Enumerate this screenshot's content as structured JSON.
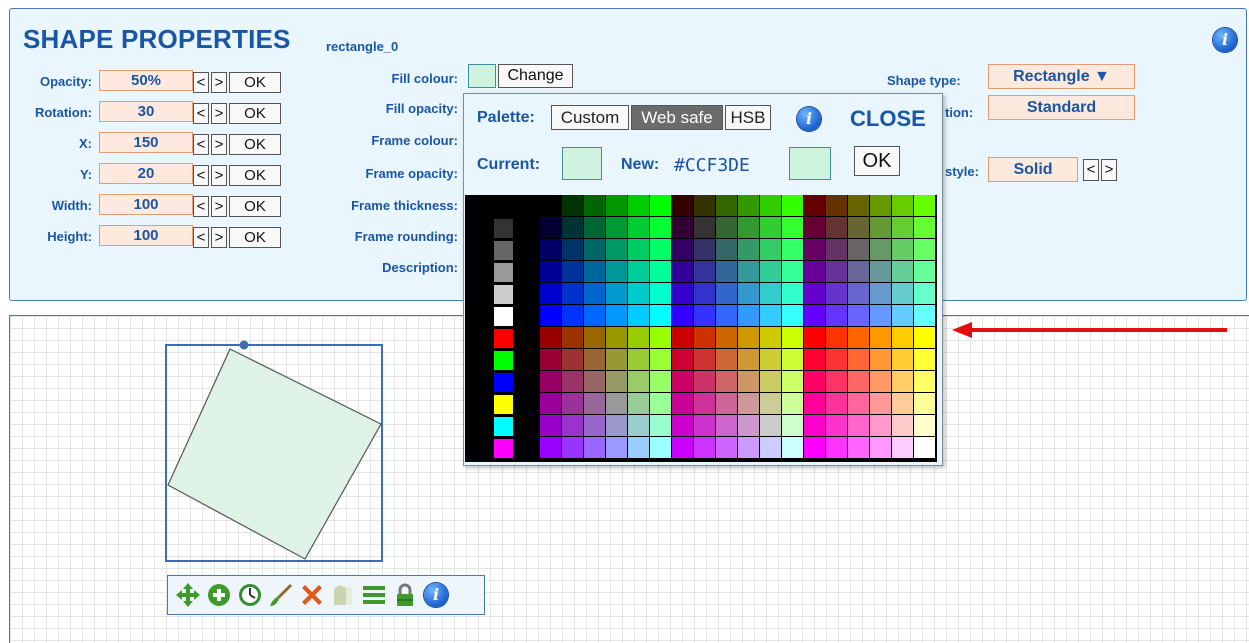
{
  "panel": {
    "title": "SHAPE PROPERTIES",
    "shape_name": "rectangle_0",
    "info_icon": "i",
    "left_fields": [
      {
        "label": "Opacity:",
        "value": "50%"
      },
      {
        "label": "Rotation:",
        "value": "30"
      },
      {
        "label": "X:",
        "value": "150"
      },
      {
        "label": "Y:",
        "value": "20"
      },
      {
        "label": "Width:",
        "value": "100"
      },
      {
        "label": "Height:",
        "value": "100"
      }
    ],
    "dec_label": "<",
    "inc_label": ">",
    "ok_label": "OK",
    "middle_labels": [
      "Fill colour:",
      "Fill opacity:",
      "Frame colour:",
      "Frame opacity:",
      "Frame thickness:",
      "Frame rounding:",
      "Description:"
    ],
    "fill_colour": "#cff3df",
    "change_label": "Change",
    "shape_type_label": "Shape type:",
    "shape_type_value": "Rectangle ▼",
    "rotation_mode_label_partial": "tion:",
    "rotation_mode_value": "Standard",
    "frame_style_label_partial": "style:",
    "frame_style_value": "Solid"
  },
  "palette": {
    "palette_label": "Palette:",
    "tabs": [
      {
        "label": "Custom",
        "active": false
      },
      {
        "label": "Web safe",
        "active": true
      },
      {
        "label": "HSB",
        "active": false
      }
    ],
    "close_label": "CLOSE",
    "current_label": "Current:",
    "current_colour": "#cff3df",
    "new_label": "New:",
    "new_value": "#CCF3DE",
    "new_colour": "#ccf3de",
    "ok_label": "OK",
    "grey_swatches": [
      "#333333",
      "#666666",
      "#999999",
      "#cccccc",
      "#ffffff"
    ],
    "primary_swatches": [
      "#ff0000",
      "#00ff00",
      "#0000ff",
      "#ffff00",
      "#00ffff",
      "#ff00ff"
    ]
  },
  "toolbar": {
    "tools": [
      "move-icon",
      "add-icon",
      "rotate-icon",
      "paint-brush-icon",
      "delete-icon",
      "layer-icon",
      "list-icon",
      "lock-icon",
      "info-icon"
    ]
  },
  "shape": {
    "fill": "#dff2e6",
    "stroke": "#555555",
    "selection_color": "#3c6eb4"
  },
  "annotation": {
    "arrow_color": "#e01010"
  }
}
